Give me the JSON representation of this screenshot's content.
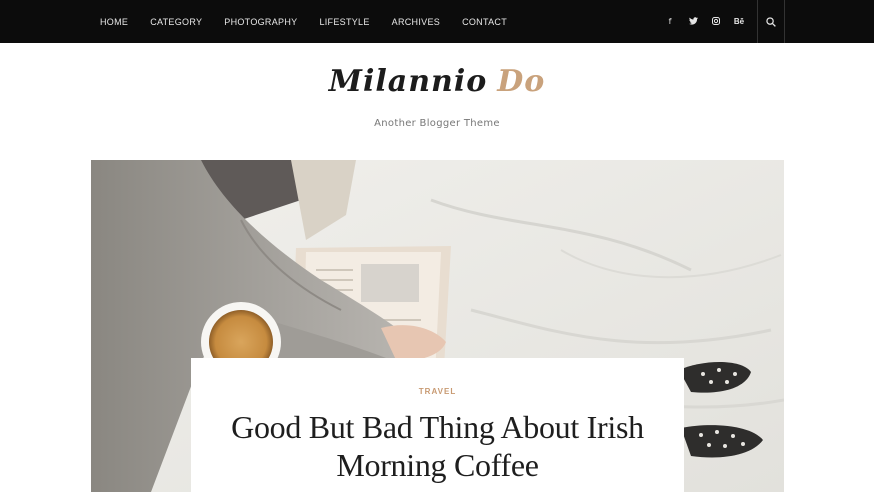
{
  "nav": {
    "items": [
      {
        "label": "HOME"
      },
      {
        "label": "CATEGORY"
      },
      {
        "label": "PHOTOGRAPHY"
      },
      {
        "label": "LIFESTYLE"
      },
      {
        "label": "ARCHIVES"
      },
      {
        "label": "CONTACT"
      }
    ],
    "social": [
      {
        "icon": "facebook-icon",
        "glyph": "f"
      },
      {
        "icon": "twitter-icon",
        "glyph": "🐦"
      },
      {
        "icon": "instagram-icon",
        "glyph": "◎"
      },
      {
        "icon": "behance-icon",
        "glyph": "Bē"
      }
    ],
    "search_icon": "search-icon"
  },
  "header": {
    "logo_part1": "Milannio",
    "logo_part2": "Do",
    "tagline": "Another Blogger Theme"
  },
  "post": {
    "category": "TRAVEL",
    "title_line1": "Good But Bad Thing About Irish",
    "title_line2": "Morning Coffee"
  },
  "colors": {
    "topbar": "#0c0c0c",
    "accent": "#c9a27c"
  }
}
